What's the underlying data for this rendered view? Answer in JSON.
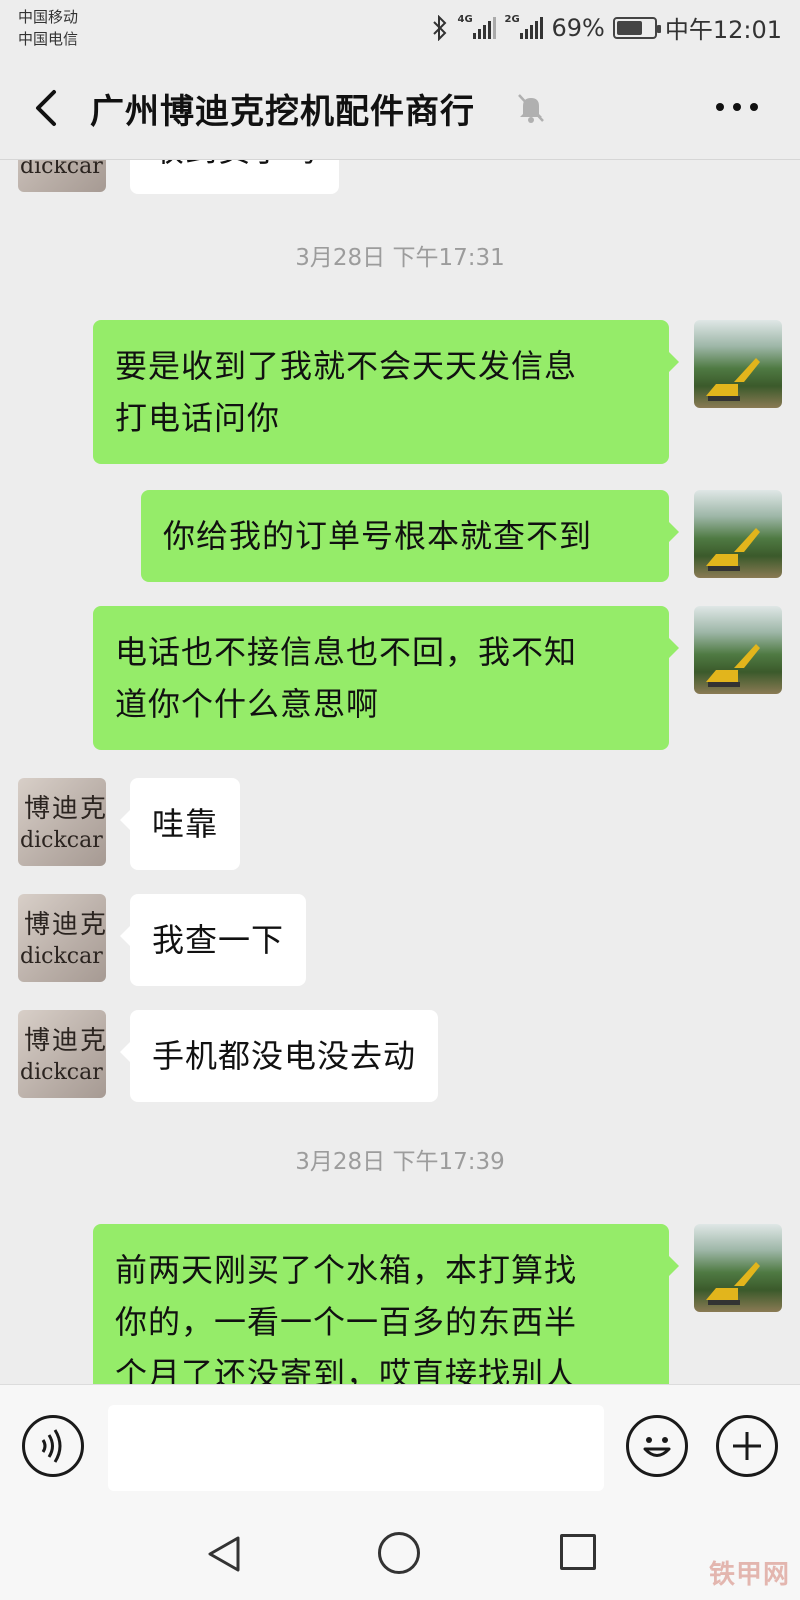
{
  "status_bar": {
    "carrier_1": "中国移动",
    "carrier_2": "中国电信",
    "network_1": "4G",
    "network_2": "2G",
    "battery": "69%",
    "battery_level": 0.69,
    "time": "中午12:01"
  },
  "header": {
    "title": "广州博迪克挖机配件商行",
    "muted": true
  },
  "contact_avatar": {
    "line_1": "博迪克",
    "line_2": "dickcar"
  },
  "chat": {
    "partial_top_message": "收到货了吗",
    "timestamp_1": "3月28日 下午17:31",
    "timestamp_2": "3月28日 下午17:39",
    "messages": [
      {
        "sender": "me",
        "text": "要是收到了我就不会天天发信息\n打电话问你"
      },
      {
        "sender": "me",
        "text": "你给我的订单号根本就查不到"
      },
      {
        "sender": "me",
        "text": "电话也不接信息也不回，我不知\n道你个什么意思啊"
      },
      {
        "sender": "them",
        "text": "哇靠"
      },
      {
        "sender": "them",
        "text": "我查一下"
      },
      {
        "sender": "them",
        "text": "手机都没电没去动"
      },
      {
        "sender": "me",
        "text": "前两天刚买了个水箱，本打算找\n你的，一看一个一百多的东西半\n个月了还没寄到，哎直接找别人"
      }
    ]
  },
  "input_bar": {
    "text_value": "",
    "voice_icon": "voice-icon",
    "emoji_icon": "emoji-icon",
    "plus_icon": "plus-icon"
  },
  "watermark": "铁甲网",
  "colors": {
    "background": "#ededed",
    "my_bubble": "#95ec69",
    "their_bubble": "#ffffff",
    "timestamp": "#9c9c9c"
  }
}
